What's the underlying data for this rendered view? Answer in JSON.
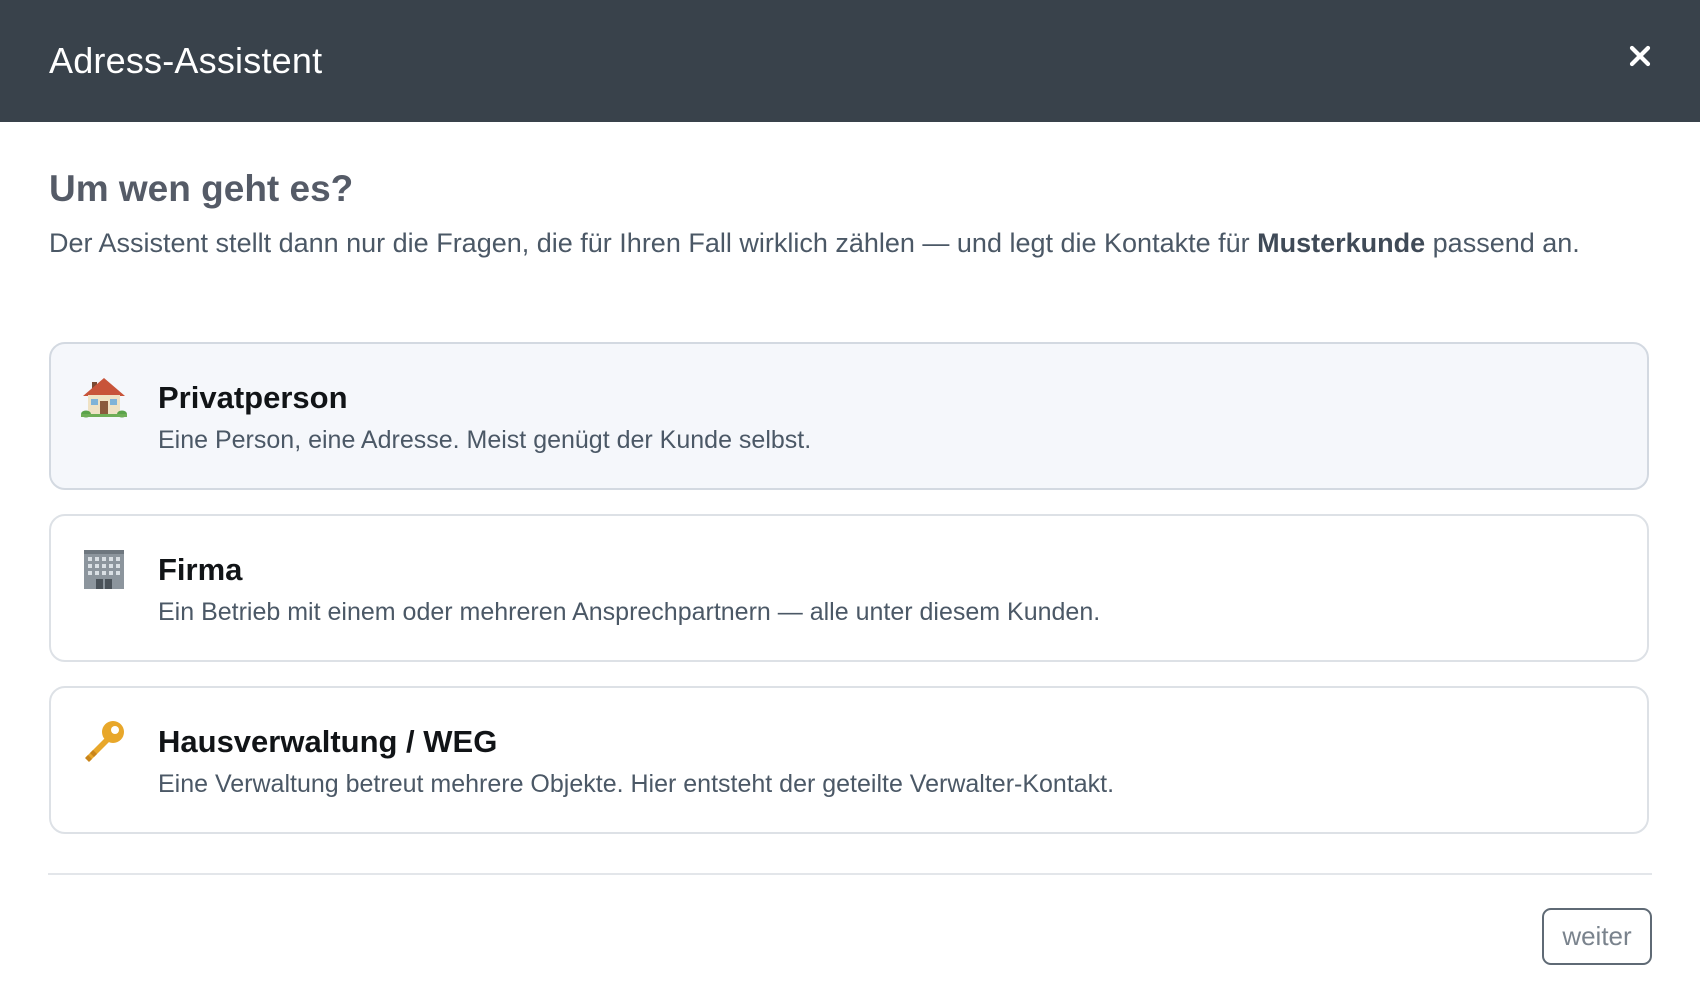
{
  "dialog": {
    "title": "Adress-Assistent",
    "close_icon": "close-icon"
  },
  "question": {
    "heading": "Um wen geht es?",
    "intro_before": "Der Assistent stellt dann nur die Fragen, die für Ihren Fall wirklich zählen — und legt die Kontakte für ",
    "intro_bold": "Musterkunde",
    "intro_after": " passend an."
  },
  "options": [
    {
      "icon": "house-icon",
      "title": "Privatperson",
      "description": "Eine Person, eine Adresse. Meist genügt der Kunde selbst.",
      "selected": true
    },
    {
      "icon": "office-building-icon",
      "title": "Firma",
      "description": "Ein Betrieb mit einem oder mehreren Ansprechpartnern — alle unter diesem Kunden.",
      "selected": false
    },
    {
      "icon": "key-icon",
      "title": "Hausverwaltung / WEG",
      "description": "Eine Verwaltung betreut mehrere Objekte. Hier entsteht der geteilte Verwalter-Kontakt.",
      "selected": false
    }
  ],
  "footer": {
    "next_label": "weiter"
  },
  "colors": {
    "header_bg": "#39424b",
    "selected_bg": "#f5f7fb",
    "border": "#dde1e6"
  }
}
